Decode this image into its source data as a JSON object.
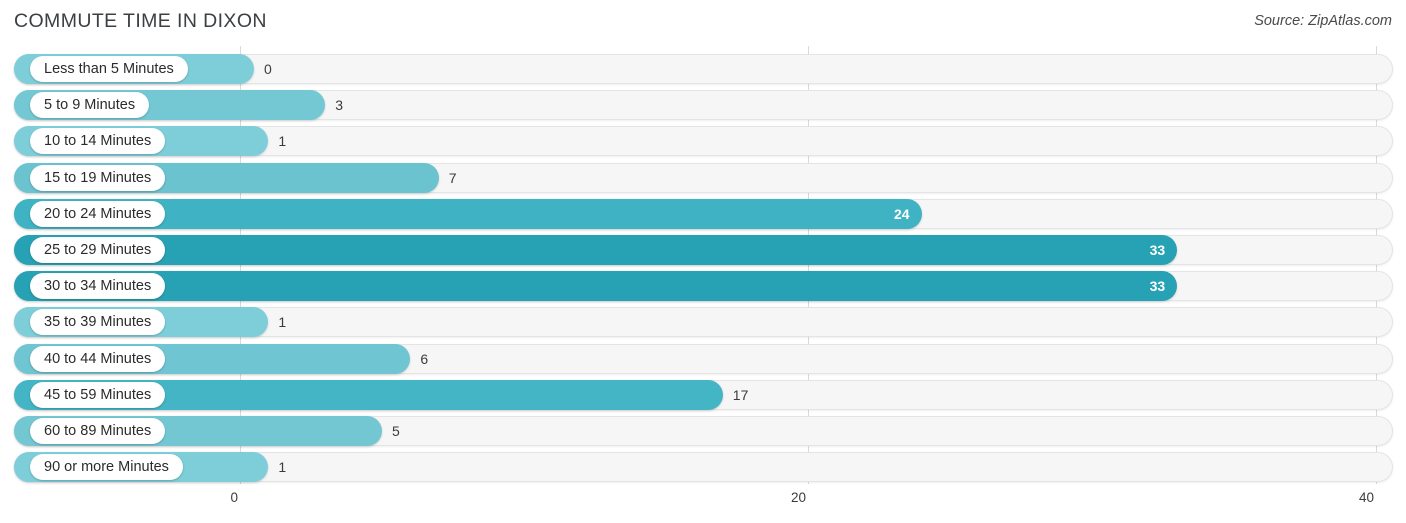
{
  "header": {
    "title": "COMMUTE TIME IN DIXON",
    "source": "Source: ZipAtlas.com"
  },
  "axis": {
    "ticks": [
      "0",
      "20",
      "40"
    ]
  },
  "chart_data": {
    "type": "bar",
    "orientation": "horizontal",
    "title": "COMMUTE TIME IN DIXON",
    "subtitle": "Source: ZipAtlas.com",
    "xlabel": "",
    "ylabel": "",
    "xlim": [
      0,
      40
    ],
    "xticks": [
      0,
      20,
      40
    ],
    "grid": true,
    "legend": false,
    "categories": [
      "Less than 5 Minutes",
      "5 to 9 Minutes",
      "10 to 14 Minutes",
      "15 to 19 Minutes",
      "20 to 24 Minutes",
      "25 to 29 Minutes",
      "30 to 34 Minutes",
      "35 to 39 Minutes",
      "40 to 44 Minutes",
      "45 to 59 Minutes",
      "60 to 89 Minutes",
      "90 or more Minutes"
    ],
    "values": [
      0,
      3,
      1,
      7,
      24,
      33,
      33,
      1,
      6,
      17,
      5,
      1
    ],
    "value_labels": [
      "0",
      "3",
      "1",
      "7",
      "24",
      "33",
      "33",
      "1",
      "6",
      "17",
      "5",
      "1"
    ],
    "bar_colors": [
      "#7ECEDA",
      "#74C8D3",
      "#7ECEDA",
      "#6BC3D0",
      "#3FB3C3",
      "#27A2B4",
      "#27A2B4",
      "#7ECEDA",
      "#6FC5D1",
      "#44B5C4",
      "#72C7D2",
      "#7ECEDA"
    ],
    "label_inside": [
      false,
      false,
      false,
      false,
      true,
      true,
      true,
      false,
      false,
      false,
      false,
      false
    ],
    "track_color": "#f6f6f6",
    "gridline_color": "#d9d9d9"
  }
}
